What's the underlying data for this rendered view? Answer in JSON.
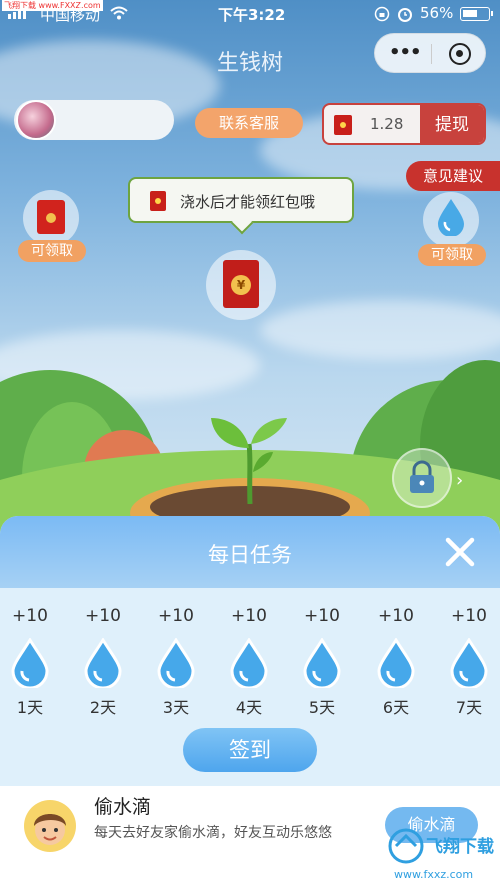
{
  "status_bar": {
    "watermark": "飞翔下载 www.FXXZ.com",
    "carrier": "中国移动",
    "time": "下午3:22",
    "battery": "56%"
  },
  "nav": {
    "title": "生钱树"
  },
  "top_bar": {
    "service_label": "联系客服",
    "balance": "1.28",
    "withdraw_label": "提现"
  },
  "feedback_label": "意见建议",
  "side_left": {
    "label": "可领取",
    "icon": "red-envelope-icon"
  },
  "side_right": {
    "label": "可领取",
    "icon": "water-drop-icon"
  },
  "tip_text": "浇水后才能领红包哦",
  "center_pack_symbol": "¥",
  "daily_task": {
    "title": "每日任务",
    "days": [
      {
        "points": "+10",
        "label": "1天"
      },
      {
        "points": "+10",
        "label": "2天"
      },
      {
        "points": "+10",
        "label": "3天"
      },
      {
        "points": "+10",
        "label": "4天"
      },
      {
        "points": "+10",
        "label": "5天"
      },
      {
        "points": "+10",
        "label": "6天"
      },
      {
        "points": "+10",
        "label": "7天"
      }
    ],
    "signin_label": "签到"
  },
  "steal_card": {
    "title": "偷水滴",
    "description": "每天去好友家偷水滴，好友互动乐悠悠",
    "button_label": "偷水滴"
  },
  "watermark_corner": "飞翔下载 www.fxxz.com",
  "colors": {
    "accent_blue": "#4ea5ed",
    "accent_red": "#c8423d",
    "accent_orange": "#f3a46b",
    "sheet_bg": "#dff0fb"
  }
}
